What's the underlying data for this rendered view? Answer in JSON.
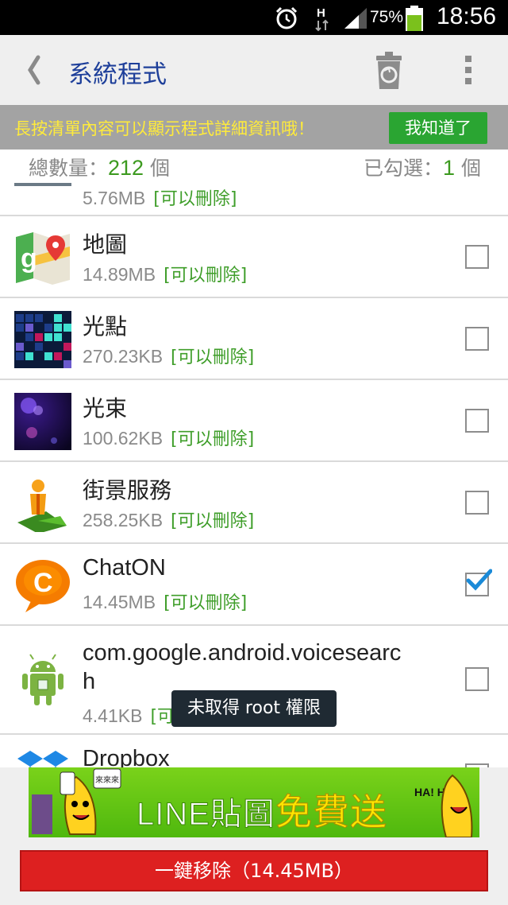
{
  "status_bar": {
    "battery_percent": "75%",
    "time": "18:56",
    "network_label": "H",
    "battery_level": 0.75
  },
  "header": {
    "title": "系統程式",
    "back_icon": "back-chevron-icon",
    "trash_icon": "recycle-bin-icon",
    "more_icon": "overflow-menu-icon"
  },
  "tip": {
    "text": "長按清單內容可以顯示程式詳細資訊哦！",
    "button": "我知道了"
  },
  "counts": {
    "total_label": "總數量：",
    "total_value": "212",
    "total_unit": " 個",
    "selected_label": "已勾選：",
    "selected_value": "1",
    "selected_unit": " 個"
  },
  "apps": [
    {
      "name": "",
      "size": "5.76MB",
      "tag": "[可以刪除]",
      "checked": false,
      "icon": "snow-scene-icon"
    },
    {
      "name": "地圖",
      "size": "14.89MB",
      "tag": "[可以刪除]",
      "checked": false,
      "icon": "google-maps-icon"
    },
    {
      "name": "光點",
      "size": "270.23KB",
      "tag": "[可以刪除]",
      "checked": false,
      "icon": "light-grid-icon"
    },
    {
      "name": "光束",
      "size": "100.62KB",
      "tag": "[可以刪除]",
      "checked": false,
      "icon": "bokeh-icon"
    },
    {
      "name": "街景服務",
      "size": "258.25KB",
      "tag": "[可以刪除]",
      "checked": false,
      "icon": "street-view-icon"
    },
    {
      "name": "ChatON",
      "size": "14.45MB",
      "tag": "[可以刪除]",
      "checked": true,
      "icon": "chaton-icon"
    },
    {
      "name_line1": "com.google.android.voicesearc",
      "name_line2": "h",
      "size": "4.41KB",
      "tag": "[可",
      "checked": false,
      "icon": "android-robot-icon"
    },
    {
      "name": "Dropbox",
      "checked": false,
      "icon": "dropbox-icon"
    }
  ],
  "toast": {
    "text": "未取得 root 權限"
  },
  "ad": {
    "text_prefix": "LINE貼圖",
    "text_free": "免費送",
    "bubble_left": "來來來",
    "bubble_right": "HA! HA!"
  },
  "bottom": {
    "remove_button": "一鍵移除（14.45MB）"
  },
  "colors": {
    "title_blue": "#1e3f9a",
    "tag_green": "#3f9e2a",
    "accent_red": "#dd2020",
    "tip_button_green": "#2aa532",
    "tip_text_yellow": "#ffeb3b"
  }
}
